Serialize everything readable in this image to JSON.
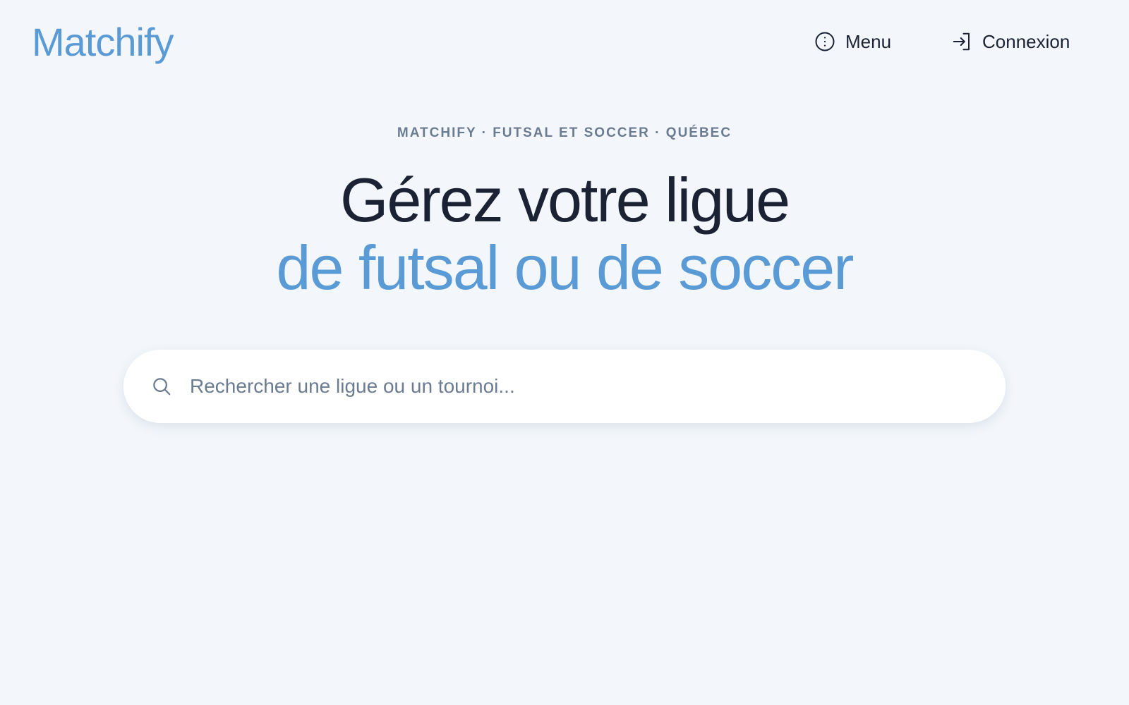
{
  "header": {
    "logo": "Matchify",
    "nav": {
      "menu": {
        "label": "Menu",
        "icon": "info-circle-icon"
      },
      "login": {
        "label": "Connexion",
        "icon": "login-arrow-icon"
      }
    }
  },
  "hero": {
    "eyebrow": "MATCHIFY · FUTSAL ET SOCCER · QUÉBEC",
    "headline_line1": "Gérez votre ligue",
    "headline_line2": "de futsal ou de soccer"
  },
  "search": {
    "placeholder": "Rechercher une ligue ou un tournoi...",
    "icon": "search-icon"
  },
  "colors": {
    "background": "#f3f7fb",
    "accent": "#5b9bd5",
    "text": "#1a2233",
    "muted": "#6b7b90"
  }
}
